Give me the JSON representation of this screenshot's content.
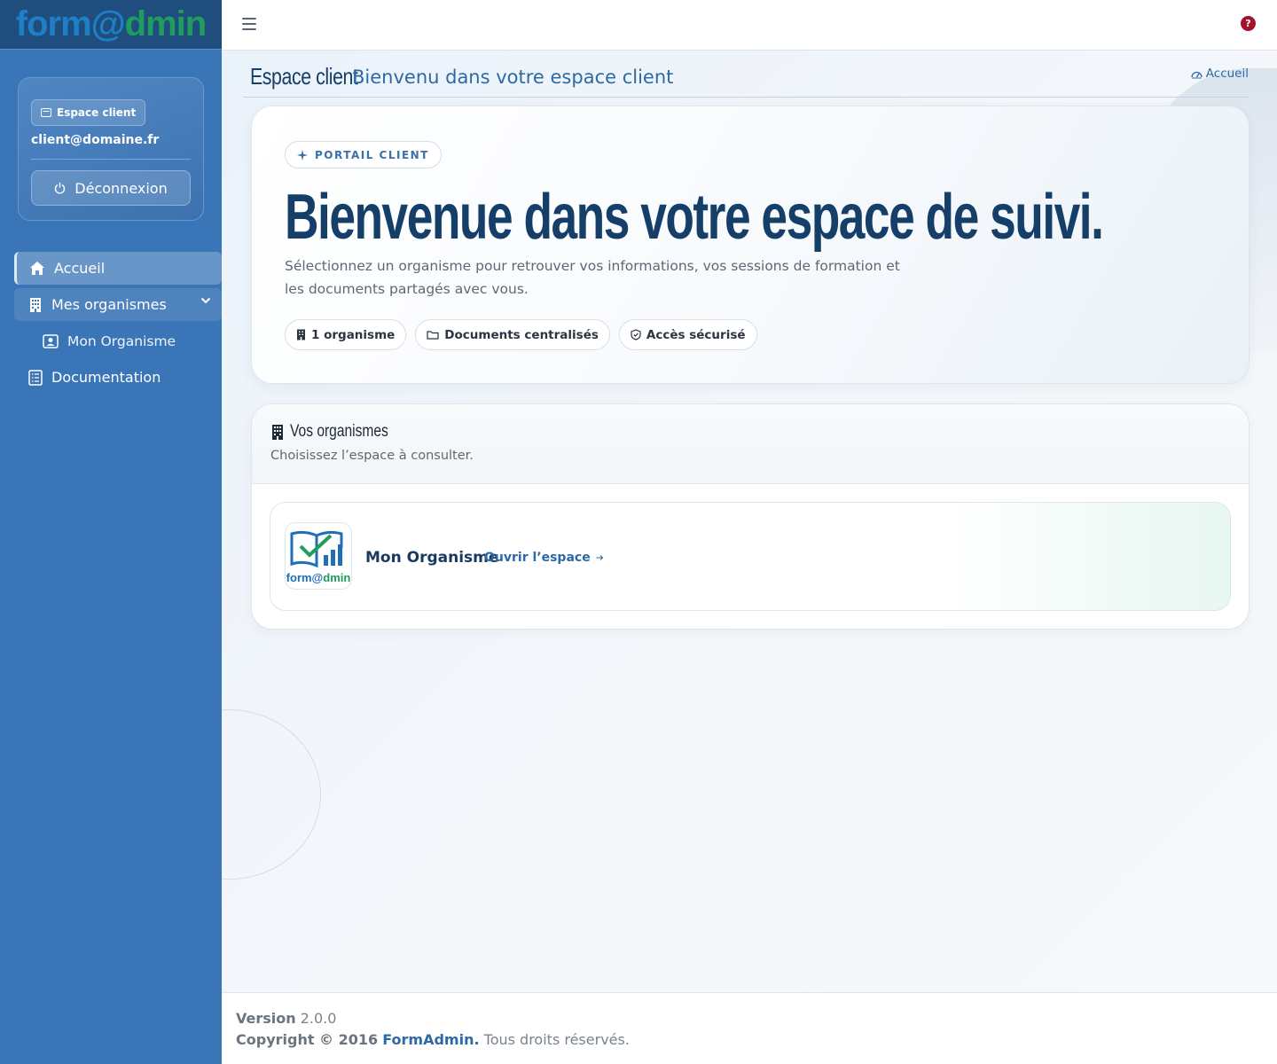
{
  "brand": {
    "part1": "form@",
    "part2": "dmin"
  },
  "user_card": {
    "badge": "Espace client",
    "email": "client@domaine.fr",
    "logout_label": "Déconnexion"
  },
  "nav": {
    "home": "Accueil",
    "orgs": "Mes organismes",
    "org_sub": "Mon Organisme",
    "docs": "Documentation"
  },
  "topbar": {
    "help_icon": "?"
  },
  "page_header": {
    "title": "Espace client",
    "subtitle": "Bienvenu dans votre espace client",
    "breadcrumb": "Accueil"
  },
  "hero": {
    "pill": "PORTAIL CLIENT",
    "title": "Bienvenue dans votre espace de suivi.",
    "desc_line1": "Sélectionnez un organisme pour retrouver vos informations, vos sessions de formation et",
    "desc_line2": "les documents partagés avec vous.",
    "tags": [
      "1 organisme",
      "Documents centralisés",
      "Accès sécurisé"
    ]
  },
  "orgs": {
    "title": "Vos organismes",
    "subtitle": "Choisissez l’espace à consulter.",
    "item": {
      "name": "Mon Organisme",
      "link": "Ouvrir l’espace",
      "logo_a": "form@",
      "logo_b": "dmin"
    }
  },
  "footer": {
    "version_label": "Version",
    "version_value": "2.0.0",
    "copyright": "Copyright © 2016",
    "company": "FormAdmin.",
    "rights": "Tous droits réservés."
  },
  "colors": {
    "sidebar": "#3a75b7",
    "brand_bar": "#1f4d7d",
    "accent": "#2c6aa6",
    "title": "#153f69",
    "help": "#a3142c"
  }
}
